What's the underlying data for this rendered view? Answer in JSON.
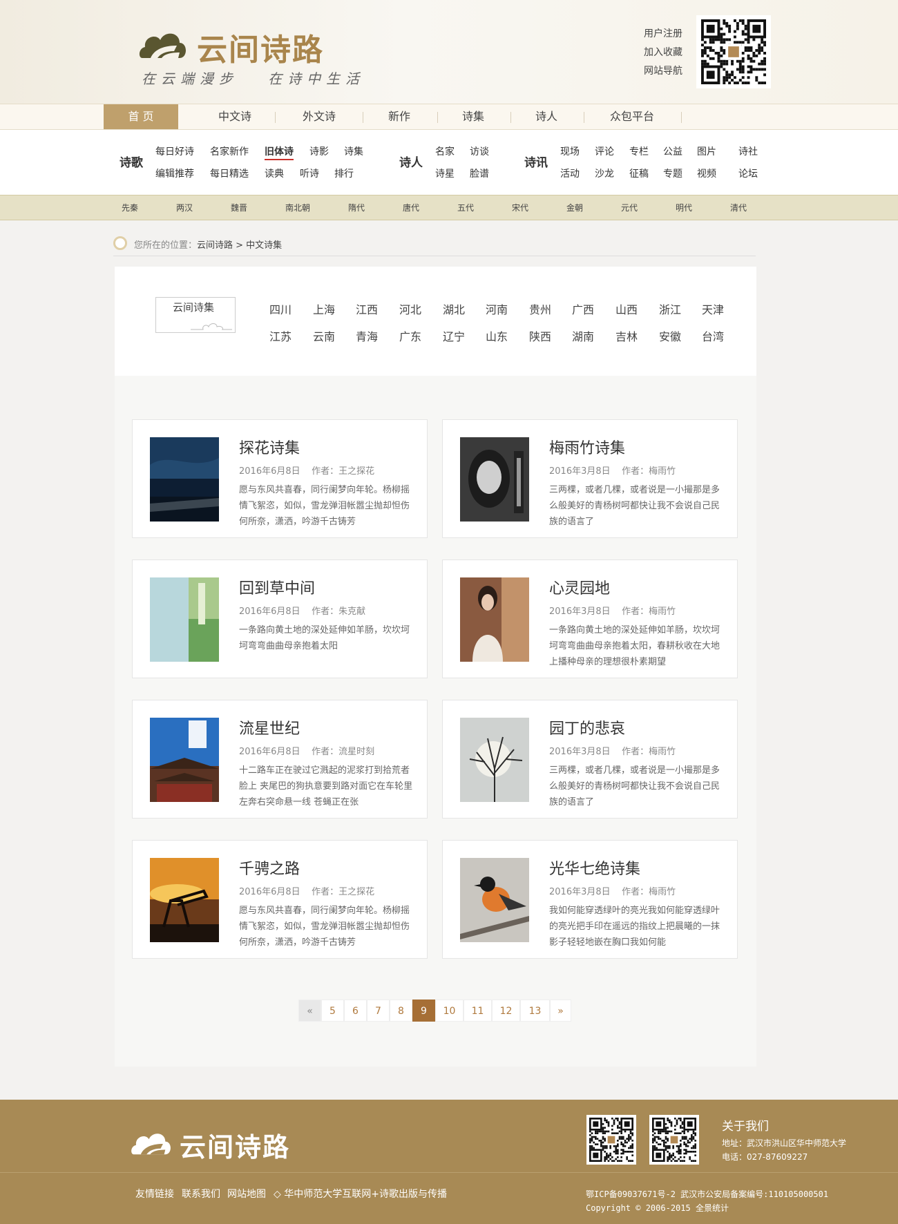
{
  "header": {
    "logo_text": "云间诗路",
    "slogan": "在云端漫步   在诗中生活",
    "top_links": [
      "用户注册",
      "加入收藏",
      "网站导航"
    ]
  },
  "main_nav": [
    "首 页",
    "中文诗",
    "外文诗",
    "新作",
    "诗集",
    "诗人",
    "众包平台"
  ],
  "sub_nav": {
    "poetry": {
      "heading": "诗歌",
      "row1": [
        "每日好诗",
        "名家新作",
        "旧体诗",
        "诗影",
        "诗集"
      ],
      "row2": [
        "编辑推荐",
        "每日精选",
        "读典",
        "听诗",
        "排行"
      ]
    },
    "poets": {
      "heading": "诗人",
      "row1": [
        "名家",
        "访谈"
      ],
      "row2": [
        "诗星",
        "脸谱"
      ]
    },
    "news": {
      "heading": "诗讯",
      "row1": [
        "现场",
        "评论",
        "专栏",
        "公益",
        "图片",
        "诗社"
      ],
      "row2": [
        "活动",
        "沙龙",
        "征稿",
        "专题",
        "视频",
        "论坛"
      ]
    }
  },
  "dynasties": [
    "先秦",
    "两汉",
    "魏晋",
    "南北朝",
    "隋代",
    "唐代",
    "五代",
    "宋代",
    "金朝",
    "元代",
    "明代",
    "清代"
  ],
  "breadcrumb": {
    "prefix": "您所在的位置：",
    "path": "云间诗路 > 中文诗集"
  },
  "region_box": {
    "label": "云间诗集",
    "row1": [
      "四川",
      "上海",
      "江西",
      "河北",
      "湖北",
      "河南",
      "贵州",
      "广西",
      "山西",
      "浙江",
      "天津"
    ],
    "row2": [
      "江苏",
      "云南",
      "青海",
      "广东",
      "辽宁",
      "山东",
      "陕西",
      "湖南",
      "吉林",
      "安徽",
      "台湾"
    ]
  },
  "collections": [
    {
      "title": "探花诗集",
      "date": "2016年6月8日",
      "author": "作者：王之探花",
      "desc": "愿与东风共喜春，同行阑梦向年轮。杨柳摇情飞絮恣，如似，雪龙弹泪帐嚣尘抛却怛伤何所奈，潇洒，吟游千古铸芳",
      "thumb": "night-sea"
    },
    {
      "title": "梅雨竹诗集",
      "date": "2016年3月8日",
      "author": "作者：梅雨竹",
      "desc": "三两棵，或者几棵，或者说是一小撮那是多么般美好的青杨树呵都快让我不会说自己民族的语言了",
      "thumb": "portrait-bw"
    },
    {
      "title": "回到草中间",
      "date": "2016年6月8日",
      "author": "作者：朱克献",
      "desc": "一条路向黄土地的深处延伸如羊肠，坎坎坷坷弯弯曲曲母亲抱着太阳",
      "thumb": "green-book"
    },
    {
      "title": "心灵园地",
      "date": "2016年3月8日",
      "author": "作者：梅雨竹",
      "desc": "一条路向黄土地的深处延伸如羊肠，坎坎坷坷弯弯曲曲母亲抱着太阳，春耕秋收在大地上播种母亲的理想很朴素期望",
      "thumb": "woman-portrait"
    },
    {
      "title": "流星世纪",
      "date": "2016年6月8日",
      "author": "作者：流星时刻",
      "desc": "十二路车正在驶过它溅起的泥浆打到拾荒者脸上 夹尾巴的狗执意要到路对面它在车轮里左奔右突命悬一线 苍蝇正在张",
      "thumb": "pagoda"
    },
    {
      "title": "园丁的悲哀",
      "date": "2016年3月8日",
      "author": "作者：梅雨竹",
      "desc": "三两棵，或者几棵，或者说是一小撮那是多么般美好的青杨树呵都快让我不会说自己民族的语言了",
      "thumb": "bare-tree"
    },
    {
      "title": "千骋之路",
      "date": "2016年6月8日",
      "author": "作者：王之探花",
      "desc": "愿与东风共喜春，同行阑梦向年轮。杨柳摇情飞絮恣，如似，雪龙弹泪帐嚣尘抛却怛伤何所奈，潇洒，吟游千古铸芳",
      "thumb": "sunset-pump"
    },
    {
      "title": "光华七绝诗集",
      "date": "2016年3月8日",
      "author": "作者：梅雨竹",
      "desc": "我如何能穿透绿叶的亮光我如何能穿透绿叶的亮光把手印在遥远的指纹上把晨曦的一抹影子轻轻地嵌在胸口我如何能",
      "thumb": "bird"
    }
  ],
  "pagination": {
    "prev": "«",
    "pages": [
      "5",
      "6",
      "7",
      "8",
      "9",
      "10",
      "11",
      "12",
      "13"
    ],
    "current": "9",
    "next": "»"
  },
  "footer": {
    "logo_text": "云间诗路",
    "about_title": "关于我们",
    "address": "地址：武汉市洪山区华中师范大学",
    "phone": "电话：027-87609227",
    "links": [
      "友情链接",
      "联系我们",
      "网站地图"
    ],
    "partner": "◇ 华中师范大学互联网+诗歌出版与传播",
    "icp": "鄂ICP备09037671号-2   武汉市公安局备案编号:110105000501",
    "copyright": "Copyright © 2006-2015 全景统计"
  },
  "colors": {
    "accent": "#bfa06c",
    "footer": "#a88a55",
    "page_active": "#a66f36",
    "dynasty_bar": "#e6e1c6"
  }
}
